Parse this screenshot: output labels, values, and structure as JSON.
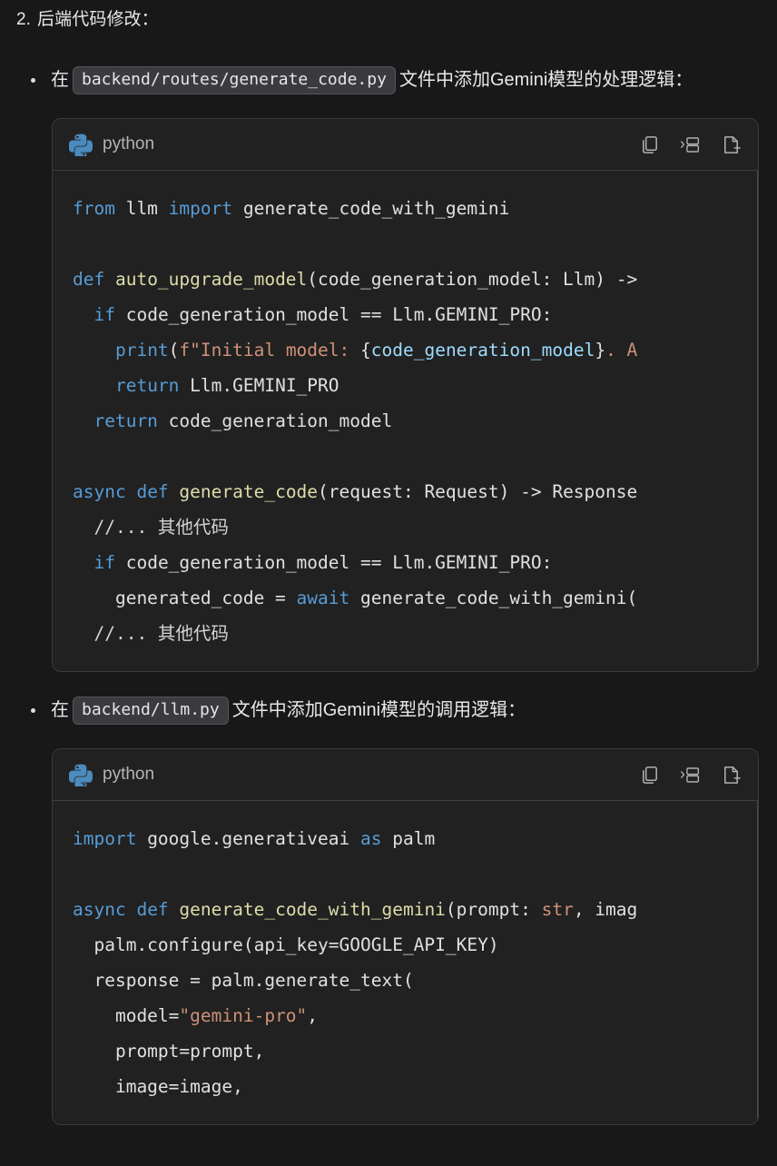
{
  "document": {
    "background_color": "#181818",
    "text_color": "#e8e8e8"
  },
  "section": {
    "number": "2.",
    "title": "后端代码修改："
  },
  "bullets": [
    {
      "lead": "在",
      "inline_code": "backend/routes/generate_code.py",
      "trail": "文件中添加Gemini模型的处理逻辑："
    },
    {
      "lead": "在",
      "inline_code": "backend/llm.py",
      "trail": "文件中添加Gemini模型的调用逻辑："
    }
  ],
  "code_blocks": [
    {
      "language_label": "python",
      "language_icon": "python-logo-icon",
      "actions": [
        {
          "name": "copy-icon",
          "label": "Copy"
        },
        {
          "name": "split-view-icon",
          "label": "Insert"
        },
        {
          "name": "new-file-icon",
          "label": "Create file"
        }
      ],
      "lines": [
        [
          {
            "t": "from ",
            "c": "kw"
          },
          {
            "t": "llm ",
            "c": "pun"
          },
          {
            "t": "import ",
            "c": "kw"
          },
          {
            "t": "generate_code_with_gemini",
            "c": "pun"
          }
        ],
        [],
        [
          {
            "t": "def ",
            "c": "kw"
          },
          {
            "t": "auto_upgrade_model",
            "c": "fn"
          },
          {
            "t": "(code_generation_model: Llm) ->",
            "c": "pun"
          }
        ],
        [
          {
            "t": "  ",
            "c": "pun"
          },
          {
            "t": "if ",
            "c": "kw"
          },
          {
            "t": "code_generation_model == Llm.GEMINI_PRO:",
            "c": "pun"
          }
        ],
        [
          {
            "t": "    ",
            "c": "pun"
          },
          {
            "t": "print",
            "c": "kw"
          },
          {
            "t": "(",
            "c": "pun"
          },
          {
            "t": "f\"Initial model: ",
            "c": "str"
          },
          {
            "t": "{",
            "c": "pun"
          },
          {
            "t": "code_generation_model",
            "c": "var"
          },
          {
            "t": "}",
            "c": "pun"
          },
          {
            "t": ". ",
            "c": "str"
          },
          {
            "t": "A",
            "c": "str"
          }
        ],
        [
          {
            "t": "    ",
            "c": "pun"
          },
          {
            "t": "return ",
            "c": "kw"
          },
          {
            "t": "Llm.GEMINI_PRO",
            "c": "pun"
          }
        ],
        [
          {
            "t": "  ",
            "c": "pun"
          },
          {
            "t": "return ",
            "c": "kw"
          },
          {
            "t": "code_generation_model",
            "c": "pun"
          }
        ],
        [],
        [
          {
            "t": "async ",
            "c": "kw"
          },
          {
            "t": "def ",
            "c": "kw"
          },
          {
            "t": "generate_code",
            "c": "fn"
          },
          {
            "t": "(request: Request) -> Response",
            "c": "pun"
          }
        ],
        [
          {
            "t": "  //... 其他代码",
            "c": "cmt"
          }
        ],
        [
          {
            "t": "  ",
            "c": "pun"
          },
          {
            "t": "if ",
            "c": "kw"
          },
          {
            "t": "code_generation_model == Llm.GEMINI_PRO:",
            "c": "pun"
          }
        ],
        [
          {
            "t": "    generated_code = ",
            "c": "pun"
          },
          {
            "t": "await ",
            "c": "kw"
          },
          {
            "t": "generate_code_with_gemini(",
            "c": "pun"
          }
        ],
        [
          {
            "t": "  //... 其他代码",
            "c": "cmt"
          }
        ]
      ]
    },
    {
      "language_label": "python",
      "language_icon": "python-logo-icon",
      "actions": [
        {
          "name": "copy-icon",
          "label": "Copy"
        },
        {
          "name": "split-view-icon",
          "label": "Insert"
        },
        {
          "name": "new-file-icon",
          "label": "Create file"
        }
      ],
      "lines": [
        [
          {
            "t": "import ",
            "c": "kw"
          },
          {
            "t": "google.generativeai ",
            "c": "pun"
          },
          {
            "t": "as ",
            "c": "kw"
          },
          {
            "t": "palm",
            "c": "pun"
          }
        ],
        [],
        [
          {
            "t": "async ",
            "c": "kw"
          },
          {
            "t": "def ",
            "c": "kw"
          },
          {
            "t": "generate_code_with_gemini",
            "c": "fn"
          },
          {
            "t": "(prompt: ",
            "c": "pun"
          },
          {
            "t": "str",
            "c": "typ"
          },
          {
            "t": ", imag",
            "c": "pun"
          }
        ],
        [
          {
            "t": "  palm.configure(api_key=GOOGLE_API_KEY)",
            "c": "pun"
          }
        ],
        [
          {
            "t": "  response = palm.generate_text(",
            "c": "pun"
          }
        ],
        [
          {
            "t": "    model=",
            "c": "pun"
          },
          {
            "t": "\"gemini-pro\"",
            "c": "str"
          },
          {
            "t": ",",
            "c": "pun"
          }
        ],
        [
          {
            "t": "    prompt=prompt,",
            "c": "pun"
          }
        ],
        [
          {
            "t": "    image=image,",
            "c": "pun"
          }
        ]
      ]
    }
  ],
  "colors": {
    "page_bg": "#181818",
    "code_bg": "#212121",
    "code_border": "#3a3a3a",
    "inline_code_bg": "#3b3b3f",
    "keyword": "#569cd6",
    "function": "#dcdcaa",
    "string": "#ce9178",
    "variable": "#9cdcfe",
    "plain": "#e0e0e0",
    "python_logo": "#4b8bbe"
  }
}
